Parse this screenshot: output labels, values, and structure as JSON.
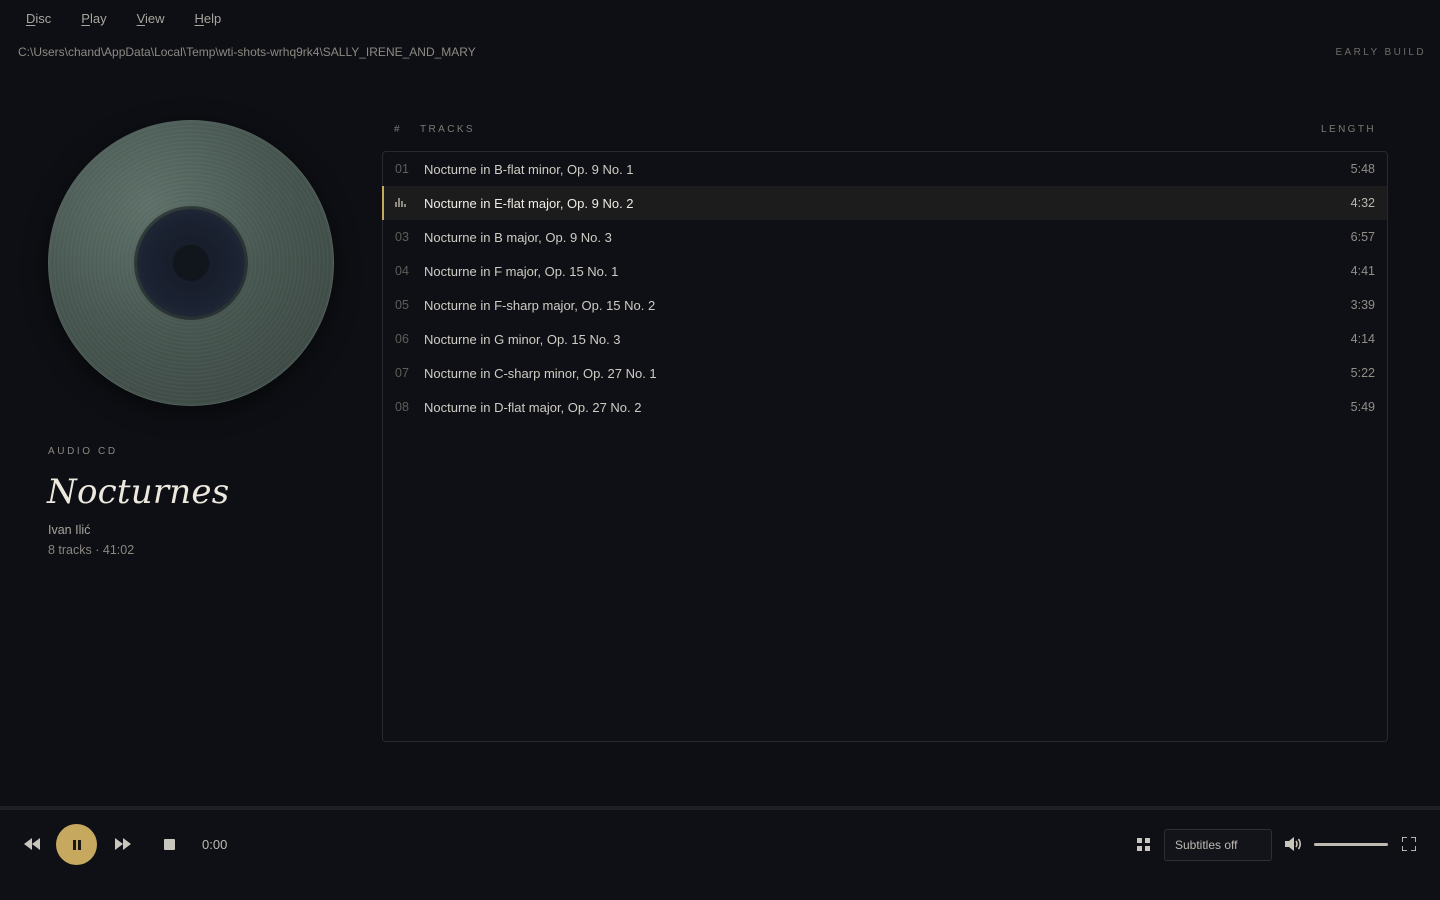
{
  "menu": [
    {
      "mnemonic": "D",
      "rest": "isc"
    },
    {
      "mnemonic": "P",
      "rest": "lay"
    },
    {
      "mnemonic": "V",
      "rest": "iew"
    },
    {
      "mnemonic": "H",
      "rest": "elp"
    }
  ],
  "path": "C:\\Users\\chand\\AppData\\Local\\Temp\\wti-shots-wrhq9rk4\\SALLY_IRENE_AND_MARY",
  "build_label": "EARLY BUILD",
  "album": {
    "kind": "AUDIO CD",
    "title": "Nocturnes",
    "artist": "Ivan Ilić",
    "meta": "8 tracks · 41:02"
  },
  "tracks_header": {
    "num": "#",
    "title": "TRACKS",
    "length": "LENGTH"
  },
  "tracks": [
    {
      "num": "01",
      "title": "Nocturne in B-flat minor, Op. 9 No. 1",
      "length": "5:48"
    },
    {
      "num": "02",
      "title": "Nocturne in E-flat major, Op. 9 No. 2",
      "length": "4:32",
      "playing": true
    },
    {
      "num": "03",
      "title": "Nocturne in B major, Op. 9 No. 3",
      "length": "6:57"
    },
    {
      "num": "04",
      "title": "Nocturne in F major, Op. 15 No. 1",
      "length": "4:41"
    },
    {
      "num": "05",
      "title": "Nocturne in F-sharp major, Op. 15 No. 2",
      "length": "3:39"
    },
    {
      "num": "06",
      "title": "Nocturne in G minor, Op. 15 No. 3",
      "length": "4:14"
    },
    {
      "num": "07",
      "title": "Nocturne in C-sharp minor, Op. 27 No. 1",
      "length": "5:22"
    },
    {
      "num": "08",
      "title": "Nocturne in D-flat major, Op. 27 No. 2",
      "length": "5:49"
    }
  ],
  "player": {
    "time": "0:00",
    "progress": 0,
    "subtitles": "Subtitles off",
    "volume": 1.0,
    "accent": "#c6a85f"
  },
  "icons": {
    "rewind": "rewind-icon",
    "pause": "pause-icon",
    "fast_forward": "fast-forward-icon",
    "stop": "stop-icon",
    "grid": "grid-icon",
    "volume": "volume-icon",
    "fullscreen": "fullscreen-icon",
    "now_playing": "equalizer-icon"
  }
}
